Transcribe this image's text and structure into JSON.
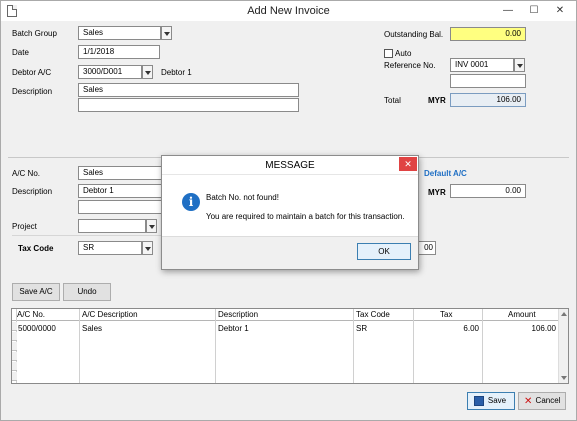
{
  "window": {
    "title": "Add New Invoice",
    "minimize": "—",
    "maximize": "☐",
    "close": "✕"
  },
  "header": {
    "batch_group_label": "Batch Group",
    "batch_group_value": "Sales",
    "date_label": "Date",
    "date_value": "1/1/2018",
    "debtor_ac_label": "Debtor A/C",
    "debtor_ac_value": "3000/D001",
    "debtor_name": "Debtor 1",
    "description_label": "Description",
    "description_line1": "Sales",
    "description_line2": "",
    "outstanding_label": "Outstanding Bal.",
    "outstanding_value": "0.00",
    "auto_label": "Auto",
    "reference_label": "Reference No.",
    "reference_value": "INV 0001",
    "reference_line2": "",
    "total_label": "Total",
    "total_currency": "MYR",
    "total_value": "106.00"
  },
  "detail": {
    "ac_no_label": "A/C No.",
    "ac_no_value": "Sales",
    "description_label": "Description",
    "description_value": "Debtor 1",
    "description_line2": "",
    "default_ac_link": "Default A/C",
    "currency": "MYR",
    "amount_value": "0.00",
    "project_label": "Project",
    "project_value": "",
    "tax_code_label": "Tax Code",
    "tax_code_value": "SR",
    "tax_amount_partial": "00"
  },
  "actions": {
    "save_ac": "Save A/C",
    "undo": "Undo",
    "save": "Save",
    "cancel": "Cancel"
  },
  "grid": {
    "columns": [
      "A/C No.",
      "A/C Description",
      "Description",
      "Tax Code",
      "Tax",
      "Amount"
    ],
    "rows": [
      [
        "5000/0000",
        "Sales",
        "Debtor 1",
        "SR",
        "6.00",
        "106.00"
      ]
    ]
  },
  "dialog": {
    "title": "MESSAGE",
    "line1": "Batch No. not found!",
    "line2": "You are required to maintain a batch for this transaction.",
    "ok": "OK",
    "close": "✕",
    "icon": "i"
  },
  "colors": {
    "outstanding_bg": "#ffff80",
    "link": "#1f6fc4",
    "info_icon": "#1f6fc4",
    "close_red": "#e04343"
  }
}
